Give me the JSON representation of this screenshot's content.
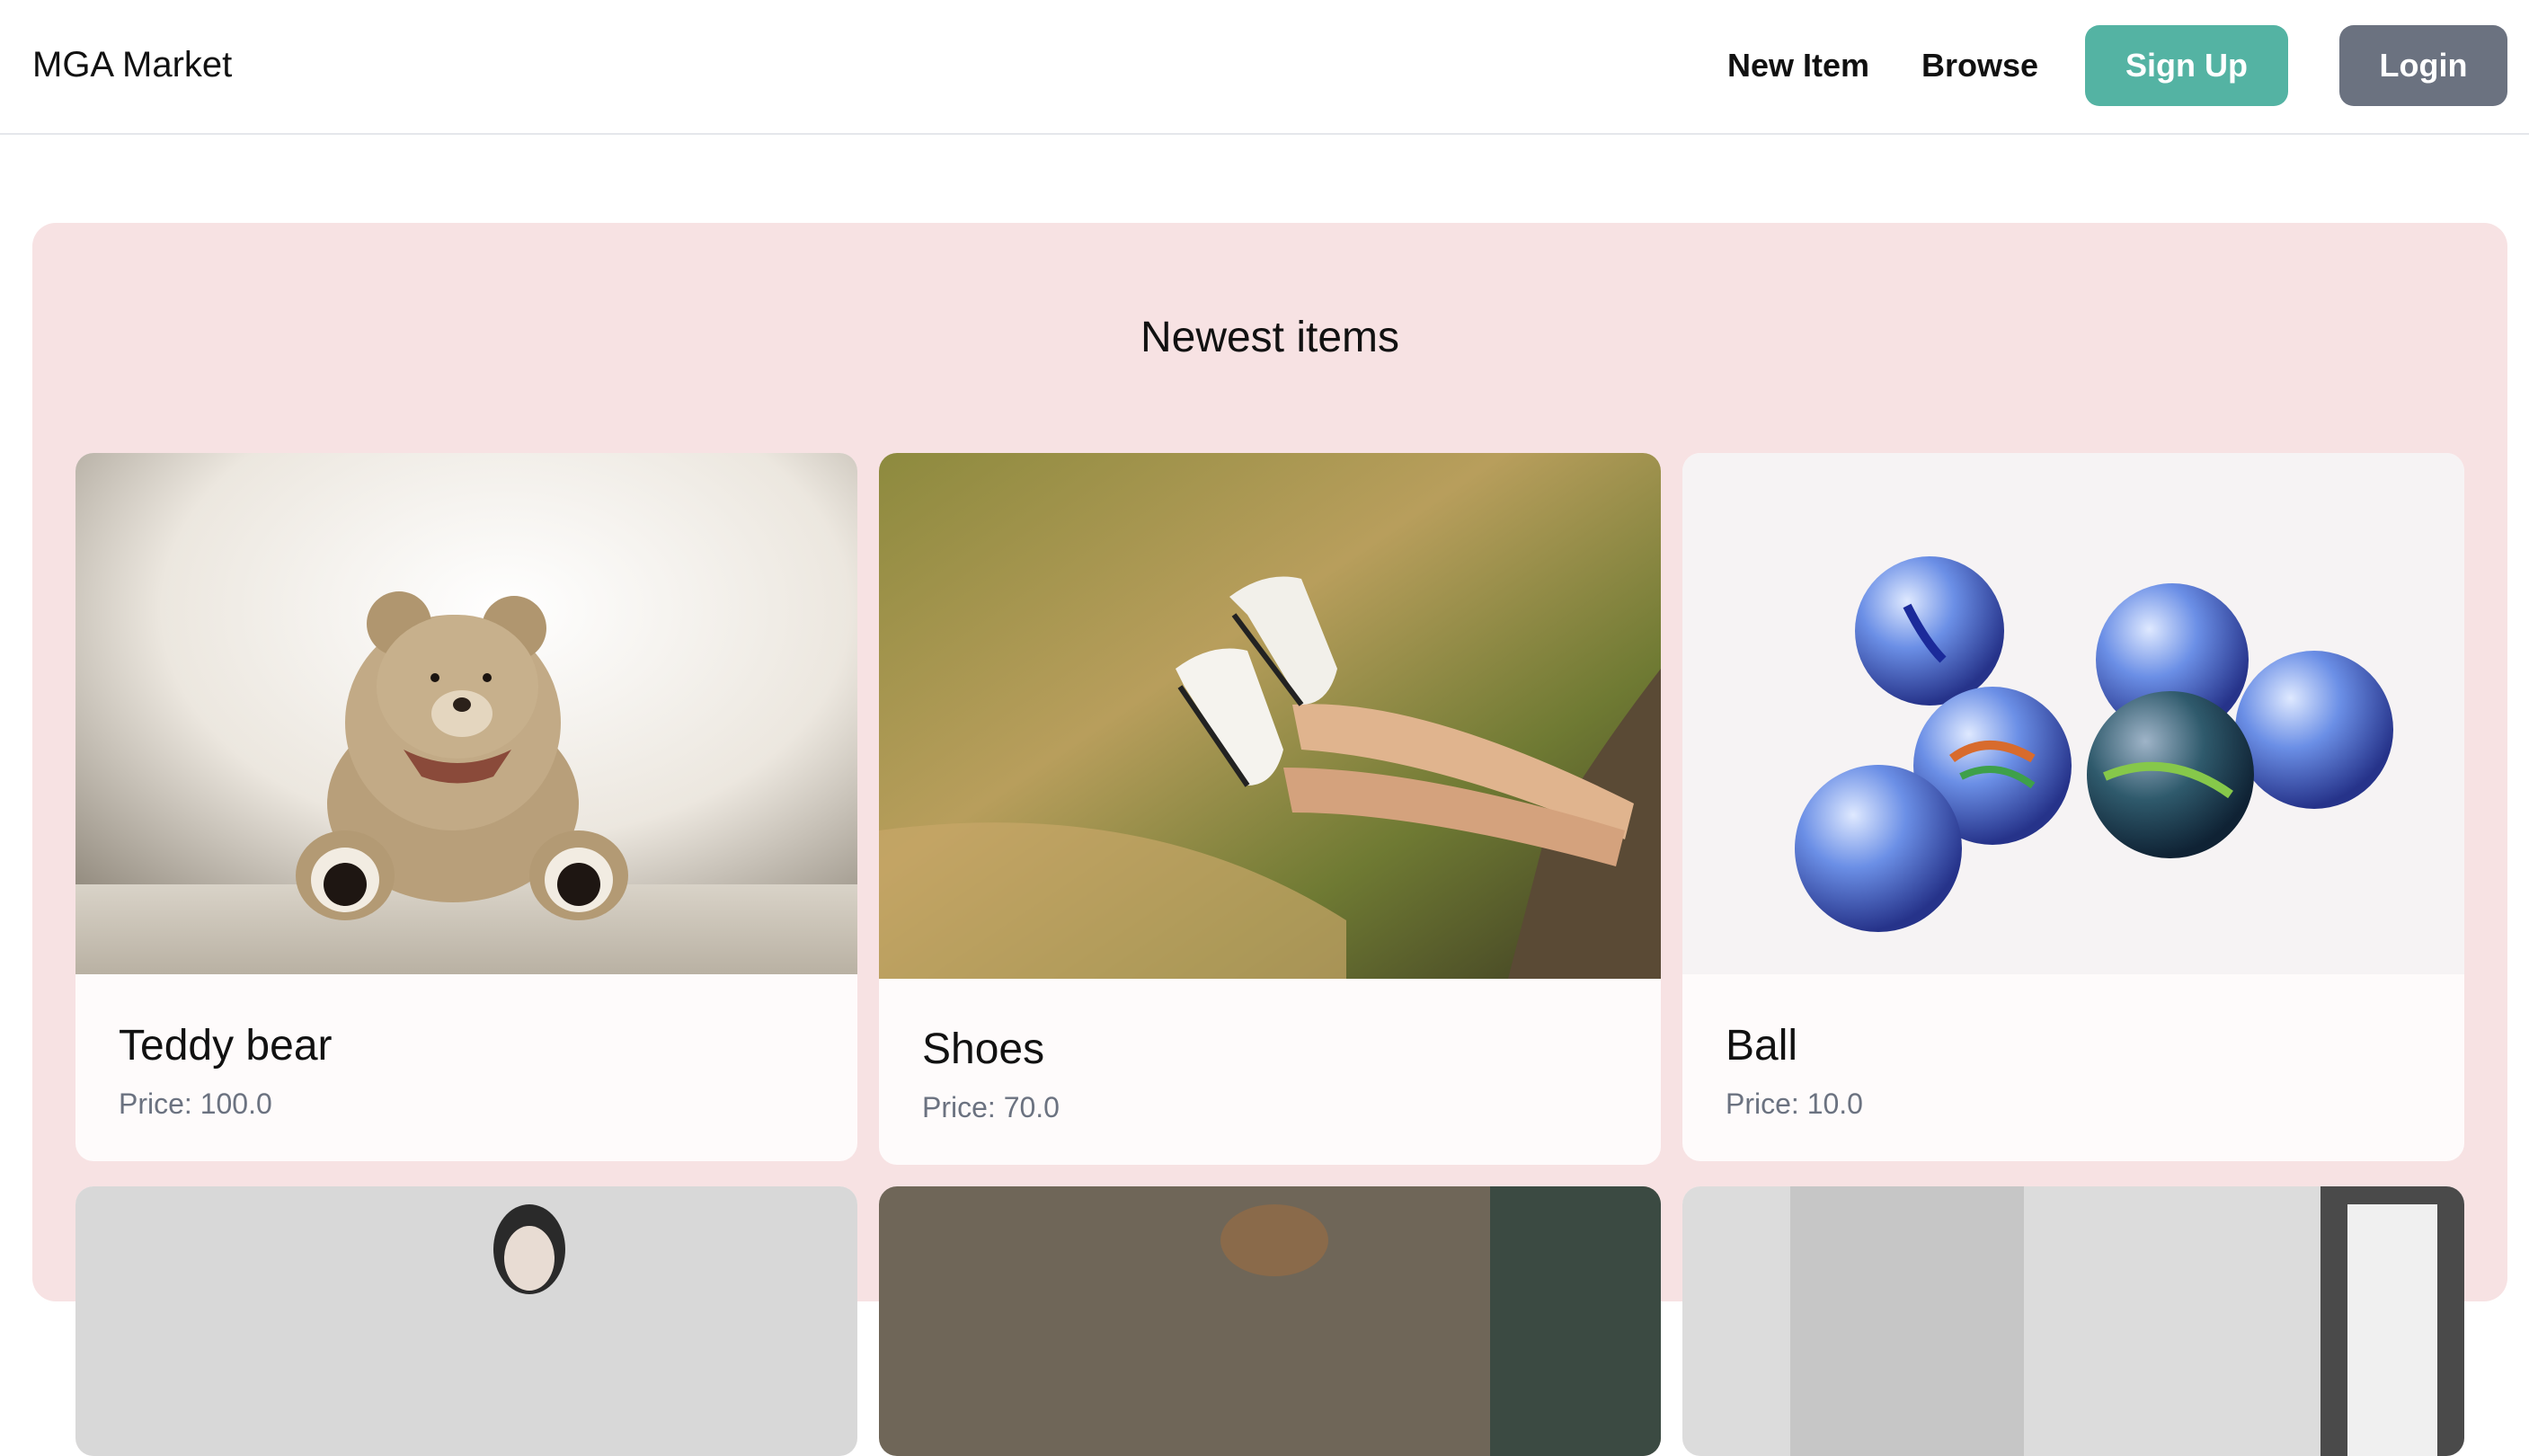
{
  "header": {
    "brand": "MGA Market",
    "nav": {
      "new_item": "New Item",
      "browse": "Browse"
    },
    "signup_label": "Sign Up",
    "login_label": "Login",
    "colors": {
      "signup": "#54b3a3",
      "login": "#6b7280"
    }
  },
  "main": {
    "section_title": "Newest items",
    "section_bg": "#f7e2e3",
    "items": [
      {
        "name": "Teddy bear",
        "price": "Price: 100.0"
      },
      {
        "name": "Shoes",
        "price": "Price: 70.0"
      },
      {
        "name": "Ball",
        "price": "Price: 10.0"
      }
    ]
  }
}
